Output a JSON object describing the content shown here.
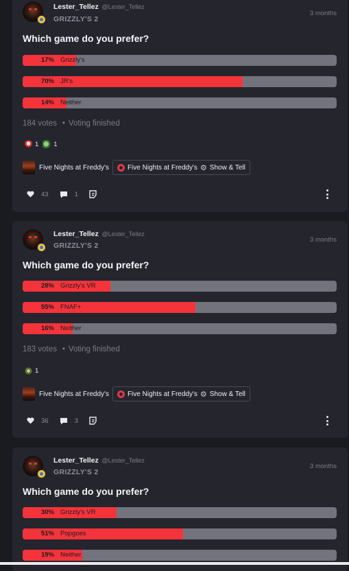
{
  "posts": [
    {
      "author": {
        "name": "Lester_Tellez",
        "handle": "@Lester_Tellez"
      },
      "community": "GRIZZLY'S 2",
      "time": "3 months",
      "question": "Which game do you prefer?",
      "options": [
        {
          "pct": "17%",
          "label": "Grizzly's",
          "fraction": 0.17
        },
        {
          "pct": "70%",
          "label": "JR's",
          "fraction": 0.7
        },
        {
          "pct": "14%",
          "label": "Neither",
          "fraction": 0.14
        }
      ],
      "votes": "184 votes",
      "status": "Voting finished",
      "reactions": [
        {
          "icon": "freddy-face-icon",
          "count": "1"
        },
        {
          "icon": "frog-icon",
          "count": "1"
        }
      ],
      "tags": {
        "community": "Five Nights at Freddy's",
        "flair_community": "Five Nights at Freddy's",
        "flair_name": "Show & Tell"
      },
      "stats": {
        "likes": "43",
        "comments": "1"
      }
    },
    {
      "author": {
        "name": "Lester_Tellez",
        "handle": "@Lester_Tellez"
      },
      "community": "GRIZZLY'S 2",
      "time": "3 months",
      "question": "Which game do you prefer?",
      "options": [
        {
          "pct": "28%",
          "label": "Grizzly's VR",
          "fraction": 0.28
        },
        {
          "pct": "55%",
          "label": "FNAF+",
          "fraction": 0.55
        },
        {
          "pct": "16%",
          "label": "Neither",
          "fraction": 0.16
        }
      ],
      "votes": "183 votes",
      "status": "Voting finished",
      "reactions": [
        {
          "icon": "owl-icon",
          "count": "1"
        }
      ],
      "tags": {
        "community": "Five Nights at Freddy's",
        "flair_community": "Five Nights at Freddy's",
        "flair_name": "Show & Tell"
      },
      "stats": {
        "likes": "36",
        "comments": "3"
      }
    },
    {
      "author": {
        "name": "Lester_Tellez",
        "handle": "@Lester_Tellez"
      },
      "community": "GRIZZLY'S 2",
      "time": "3 months",
      "question": "Which game do you prefer?",
      "options": [
        {
          "pct": "30%",
          "label": "Grizzly's VR",
          "fraction": 0.3
        },
        {
          "pct": "51%",
          "label": "Popgoes",
          "fraction": 0.51
        },
        {
          "pct": "19%",
          "label": "Neither",
          "fraction": 0.19
        }
      ]
    }
  ],
  "colors": {
    "accent": "#f5333a",
    "track": "#73737e",
    "card": "#25252e",
    "background": "#1a1a21"
  }
}
